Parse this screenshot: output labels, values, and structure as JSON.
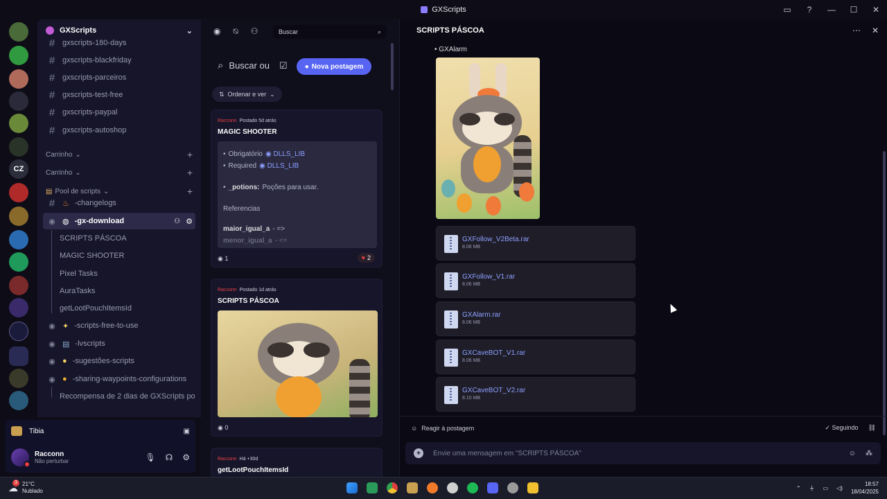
{
  "window": {
    "title": "GXScripts"
  },
  "server": {
    "name": "GXScripts",
    "rail_letters": "CZ"
  },
  "channels": [
    {
      "name": "gxscripts-180-days"
    },
    {
      "name": "gxscripts-blackfriday"
    },
    {
      "name": "gxscripts-parceiros"
    },
    {
      "name": "gxscripts-test-free"
    },
    {
      "name": "gxscripts-paypal"
    },
    {
      "name": "gxscripts-autoshop"
    }
  ],
  "categories": {
    "carrinho_1": "Carrinho",
    "carrinho_2": "Carrinho",
    "pool": "Pool de scripts"
  },
  "pool_channels": {
    "changelogs": "-changelogs",
    "gx_download": "-gx-download",
    "threads": [
      "SCRIPTS PÁSCOA",
      "MAGIC SHOOTER",
      "Pixel Tasks",
      "AuraTasks",
      "getLootPouchItemsId"
    ],
    "scripts_free": "-scripts-free-to-use",
    "lvscripts": "-lvscripts",
    "sugestoes": "-sugestões-scripts",
    "sharing": "-sharing-waypoints-configurations",
    "recompensa": "Recompensa de 2 dias de GXScripts po..."
  },
  "game_activity": {
    "name": "Tibia"
  },
  "user": {
    "name": "Racconn",
    "status": "Não perturbar"
  },
  "forum": {
    "search_placeholder": "Buscar",
    "big_search": "Buscar ou",
    "new_post": "Nova postagem",
    "sort": "Ordenar e ver",
    "posts": [
      {
        "author": "Racconn",
        "time": "Postado 5d atrás",
        "title": "MAGIC SHOOTER",
        "lines": {
          "l1a": "Obrigatório",
          "l1b": "DLLS_LIB",
          "l2a": "Required",
          "l2b": "DLLS_LIB",
          "l3a": "_potions:",
          "l3b": "Poções para usar.",
          "l4": "Referencias",
          "l5a": "maior_igual_a",
          "l5b": "- =>",
          "l6a": "menor_igual_a",
          "l6b": "- <="
        },
        "comments": "1",
        "reactions": "2"
      },
      {
        "author": "Racconn",
        "time": "Postado 1d atrás",
        "title": "SCRIPTS PÁSCOA",
        "comments": "0"
      },
      {
        "author": "Racconn",
        "time": "Há +30d",
        "title": "getLootPouchItemsId"
      }
    ]
  },
  "post": {
    "title": "SCRIPTS PÁSCOA",
    "bullet": "GXAlarm",
    "files": [
      {
        "name": "GXFollow_V2Beta.rar",
        "size": "8.06 MB"
      },
      {
        "name": "GXFollow_V1.rar",
        "size": "8.06 MB"
      },
      {
        "name": "GXAlarm.rar",
        "size": "8.06 MB"
      },
      {
        "name": "GXCaveBOT_V1.rar",
        "size": "8.06 MB"
      },
      {
        "name": "GXCaveBOT_V2.rar",
        "size": "8.10 MB"
      }
    ],
    "react_label": "Reagir à postagem",
    "following_label": "Seguindo",
    "message_placeholder": "Envie uma mensagem em \"SCRIPTS PÁSCOA\""
  },
  "taskbar": {
    "temp": "21°C",
    "weather": "Nublado",
    "time": "18:57",
    "date": "18/04/2025",
    "notif_count": "3"
  },
  "colors": {
    "accent": "#5865f2",
    "link": "#8ea1ff",
    "danger": "#ed4245"
  }
}
